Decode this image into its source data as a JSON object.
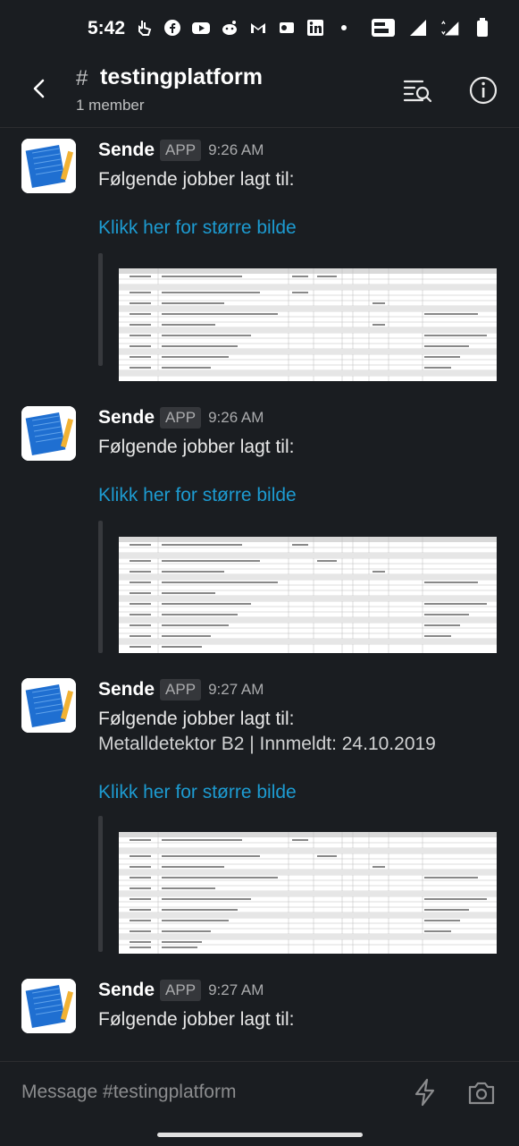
{
  "status": {
    "time": "5:42"
  },
  "header": {
    "hash": "#",
    "channel": "testingplatform",
    "members": "1 member"
  },
  "messages": [
    {
      "sender": "Sende",
      "badge": "APP",
      "time": "9:26 AM",
      "text": "Følgende jobber lagt til:",
      "sub": "",
      "link": "Klikk her for større bilde"
    },
    {
      "sender": "Sende",
      "badge": "APP",
      "time": "9:26 AM",
      "text": "Følgende jobber lagt til:",
      "sub": "",
      "link": "Klikk her for større bilde"
    },
    {
      "sender": "Sende",
      "badge": "APP",
      "time": "9:27 AM",
      "text": "Følgende jobber lagt til:",
      "sub": "Metalldetektor B2 | Innmeldt: 24.10.2019",
      "link": "Klikk her for større bilde"
    },
    {
      "sender": "Sende",
      "badge": "APP",
      "time": "9:27 AM",
      "text": "Følgende jobber lagt til:",
      "sub": "",
      "link": ""
    }
  ],
  "composer": {
    "placeholder": "Message #testingplatform"
  },
  "colors": {
    "background": "#1a1d21",
    "link": "#1d9bd1",
    "badge_bg": "#35373b"
  },
  "icons": [
    "back-icon",
    "search-list-icon",
    "info-icon",
    "lightning-icon",
    "camera-icon"
  ]
}
